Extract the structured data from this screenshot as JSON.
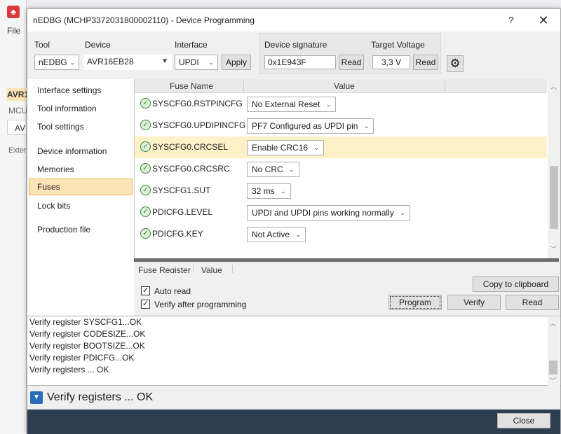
{
  "background_app": {
    "menu_file": "File",
    "side_texts": [
      "AVR1",
      "MCU",
      "AV",
      "Exter"
    ]
  },
  "window": {
    "title": "nEDBG (MCHP3372031800002110) - Device Programming",
    "help": "?",
    "close": "✕"
  },
  "toolbar": {
    "tool_label": "Tool",
    "tool_value": "nEDBG",
    "device_label": "Device",
    "device_value": "AVR16EB28",
    "interface_label": "Interface",
    "interface_value": "UPDI",
    "apply": "Apply",
    "signature_label": "Device signature",
    "signature_value": "0x1E943F",
    "signature_read": "Read",
    "voltage_label": "Target Voltage",
    "voltage_value": "3,3 V",
    "voltage_read": "Read"
  },
  "nav": {
    "items": [
      {
        "label": "Interface settings"
      },
      {
        "label": "Tool information"
      },
      {
        "label": "Tool settings"
      },
      {
        "label": "Device information"
      },
      {
        "label": "Memories"
      },
      {
        "label": "Fuses"
      },
      {
        "label": "Lock bits"
      },
      {
        "label": "Production file"
      }
    ],
    "selected": "Fuses"
  },
  "fuses": {
    "header_name": "Fuse Name",
    "header_value": "Value",
    "rows": [
      {
        "name": "SYSCFG0.RSTPINCFG",
        "value": "No External Reset"
      },
      {
        "name": "SYSCFG0.UPDIPINCFG",
        "value": "PF7 Configured as UPDI pin"
      },
      {
        "name": "SYSCFG0.CRCSEL",
        "value": "Enable CRC16"
      },
      {
        "name": "SYSCFG0.CRCSRC",
        "value": "No CRC"
      },
      {
        "name": "SYSCFG1.SUT",
        "value": "32 ms"
      },
      {
        "name": "PDICFG.LEVEL",
        "value": "UPDI and UPDI pins working normally"
      },
      {
        "name": "PDICFG.KEY",
        "value": "Not Active"
      }
    ],
    "highlighted_row": "SYSCFG0.CRCSEL",
    "highlight_color": "#fcf1c8"
  },
  "register_table": {
    "header_register": "Fuse Register",
    "header_value": "Value"
  },
  "options": {
    "auto_read": "Auto read",
    "verify_after": "Verify after programming",
    "copy_clipboard": "Copy to clipboard",
    "program": "Program",
    "verify": "Verify",
    "read": "Read"
  },
  "log": {
    "lines": [
      "Verify register SYSCFG1...OK",
      "Verify register CODESIZE...OK",
      "Verify register BOOTSIZE...OK",
      "Verify register PDICFG...OK",
      "Verify registers ... OK"
    ]
  },
  "status": {
    "text": "Verify registers ... OK"
  },
  "footer": {
    "close": "Close",
    "bar_color": "#2d3e50"
  }
}
